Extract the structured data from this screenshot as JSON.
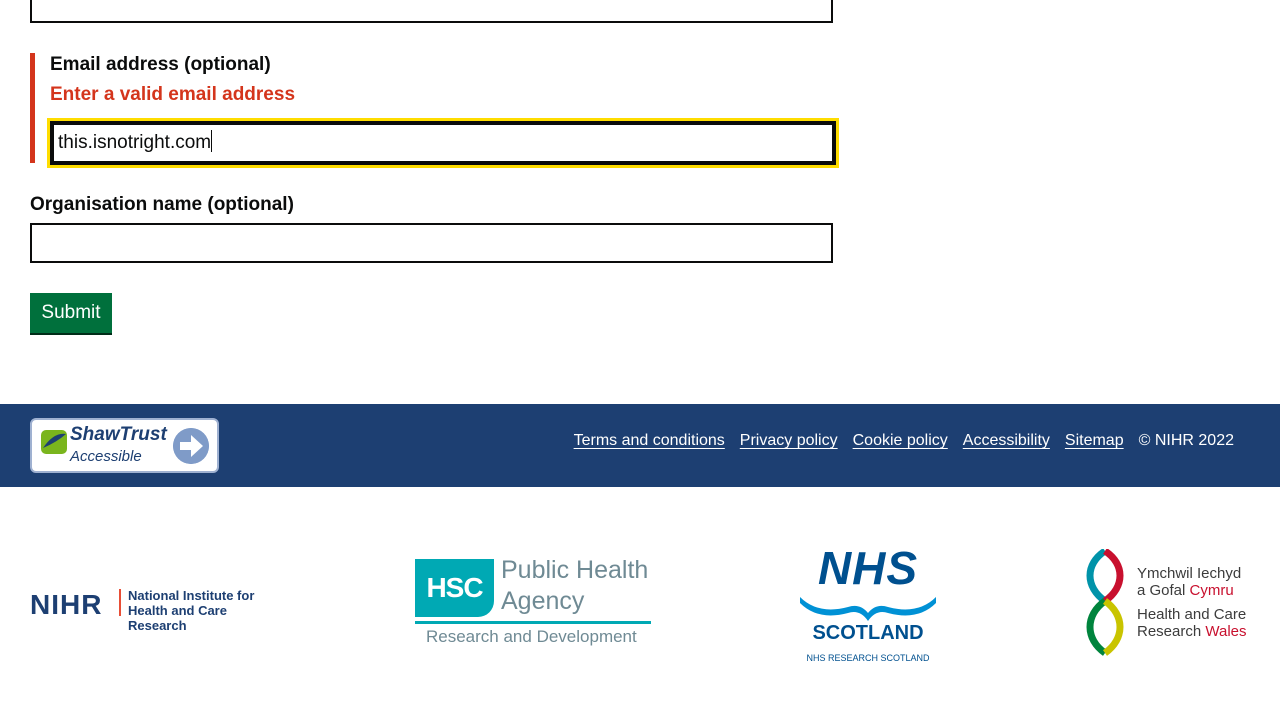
{
  "form": {
    "email": {
      "label": "Email address (optional)",
      "error": "Enter a valid email address",
      "value": "this.isnotright.com"
    },
    "organisation": {
      "label": "Organisation name (optional)",
      "value": ""
    },
    "submit_label": "Submit"
  },
  "footer": {
    "badge": {
      "title": "ShawTrust",
      "subtitle": "Accessible"
    },
    "links": [
      "Terms and conditions",
      "Privacy policy",
      "Cookie policy",
      "Accessibility",
      "Sitemap"
    ],
    "copyright": "© NIHR 2022"
  },
  "partners": {
    "nihr": {
      "mark": "NIHR",
      "line1": "National Institute for",
      "line2": "Health and Care Research"
    },
    "hsc": {
      "box": "HSC",
      "line1": "Public Health",
      "line2": "Agency",
      "sub": "Research and Development"
    },
    "nhs": {
      "mark": "NHS",
      "region": "SCOTLAND",
      "sub": "NHS RESEARCH SCOTLAND"
    },
    "hcrw": {
      "line1": "Ymchwil Iechyd",
      "line2a": "a Gofal ",
      "line2b": "Cymru",
      "line3": "Health and Care",
      "line4a": "Research ",
      "line4b": "Wales"
    }
  },
  "colors": {
    "error": "#d4351c",
    "focus": "#ffdd00",
    "button": "#00703c",
    "footer": "#1d3f72"
  }
}
